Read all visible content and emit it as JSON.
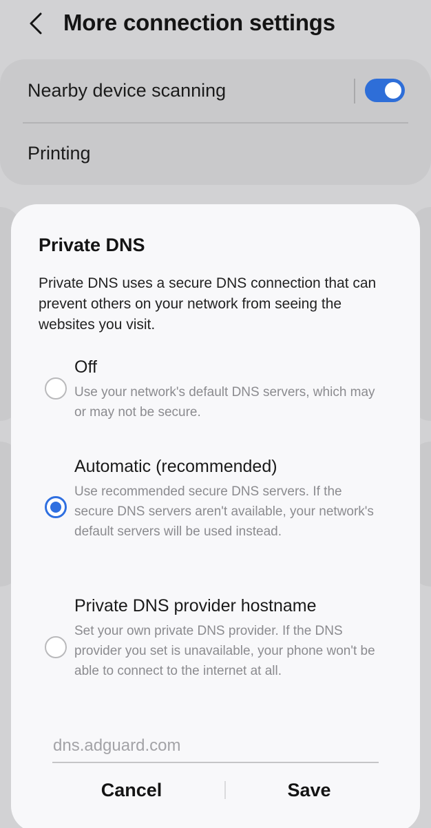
{
  "header": {
    "back_icon": "chevron-left-icon",
    "title": "More connection settings"
  },
  "settings": {
    "nearby_scanning": {
      "label": "Nearby device scanning",
      "toggle_on": true,
      "toggle_color": "#2e6ed8"
    },
    "printing": {
      "label": "Printing"
    }
  },
  "dialog": {
    "title": "Private DNS",
    "description": "Private DNS uses a secure DNS connection that can prevent others on your network from seeing the websites you visit.",
    "options": [
      {
        "title": "Off",
        "description": "Use your network's default DNS servers, which may or may not be secure.",
        "selected": false
      },
      {
        "title": "Automatic (recommended)",
        "description": "Use recommended secure DNS servers. If the secure DNS servers aren't available, your network's default servers will be used instead.",
        "selected": true
      },
      {
        "title": "Private DNS provider hostname",
        "description": "Set your own private DNS provider. If the DNS provider you set is unavailable, your phone won't be able to connect to the internet at all.",
        "selected": false
      }
    ],
    "hostname_placeholder": "dns.adguard.com",
    "cancel_label": "Cancel",
    "save_label": "Save",
    "accent_color": "#2f6fe0"
  }
}
